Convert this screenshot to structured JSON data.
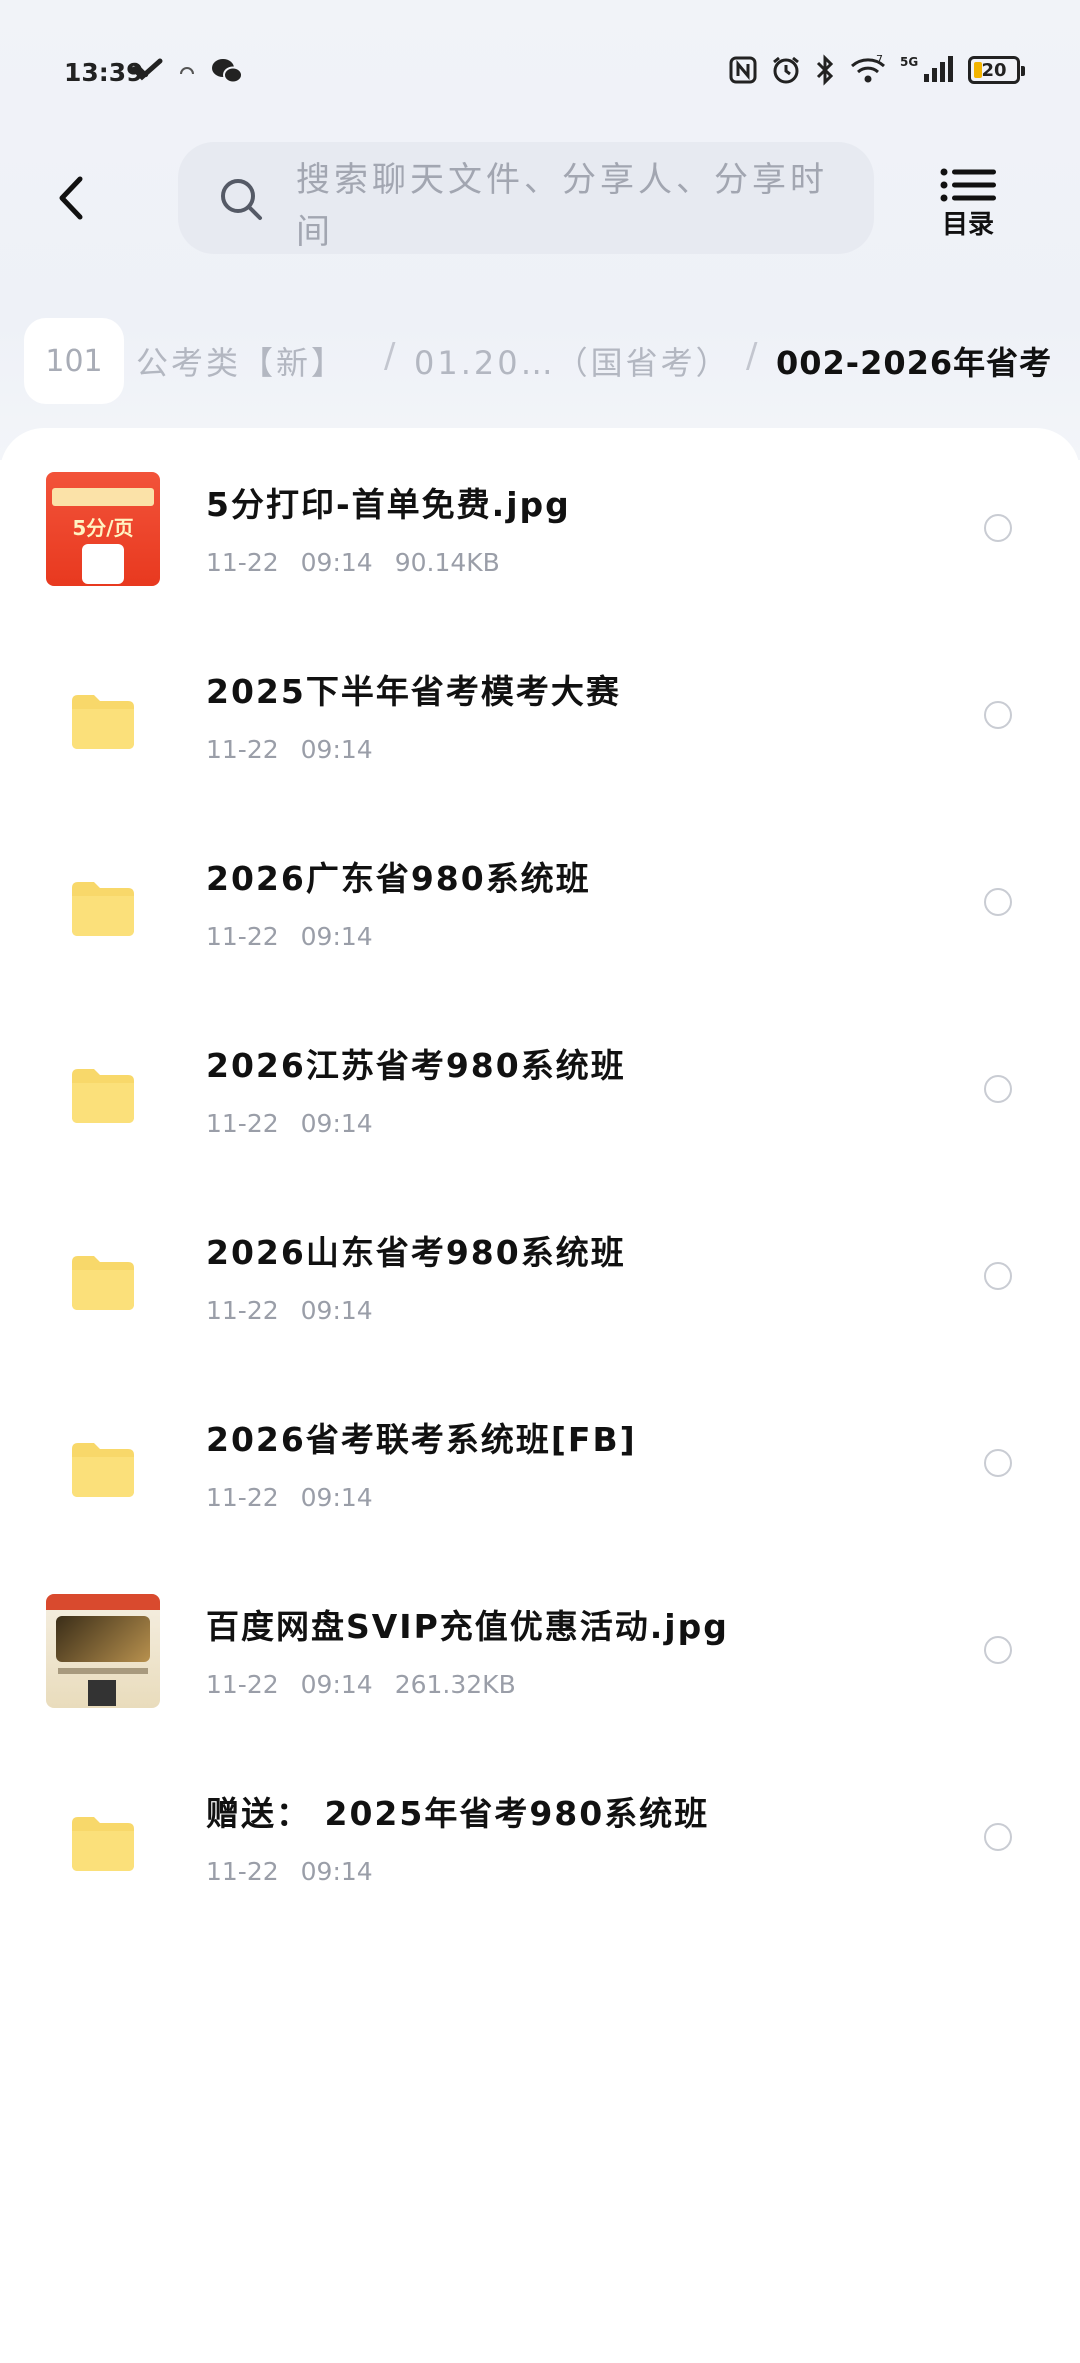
{
  "status_bar": {
    "time": "13:39",
    "battery": "20",
    "network": "5G",
    "wifi_badge": "7"
  },
  "header": {
    "search_placeholder": "搜索聊天文件、分享人、分享时间",
    "menu_label": "目录"
  },
  "breadcrumb": {
    "count": "101",
    "items": [
      {
        "label": "公考类【新】"
      },
      {
        "label": "01.20…（国省考）"
      },
      {
        "label": "002-2026年省考"
      }
    ]
  },
  "files": [
    {
      "name": "5分打印-首单免费.jpg",
      "date": "11-22",
      "time": "09:14",
      "size": "90.14KB",
      "type": "image",
      "thumb_text": "5分/页"
    },
    {
      "name": "2025下半年省考模考大赛",
      "date": "11-22",
      "time": "09:14",
      "size": "",
      "type": "folder"
    },
    {
      "name": "2026广东省980系统班",
      "date": "11-22",
      "time": "09:14",
      "size": "",
      "type": "folder"
    },
    {
      "name": "2026江苏省考980系统班",
      "date": "11-22",
      "time": "09:14",
      "size": "",
      "type": "folder"
    },
    {
      "name": "2026山东省考980系统班",
      "date": "11-22",
      "time": "09:14",
      "size": "",
      "type": "folder"
    },
    {
      "name": "2026省考联考系统班[FB]",
      "date": "11-22",
      "time": "09:14",
      "size": "",
      "type": "folder"
    },
    {
      "name": "百度网盘SVIP充值优惠活动.jpg",
      "date": "11-22",
      "time": "09:14",
      "size": "261.32KB",
      "type": "image"
    },
    {
      "name": "赠送： 2025年省考980系统班",
      "date": "11-22",
      "time": "09:14",
      "size": "",
      "type": "folder"
    }
  ],
  "colors": {
    "folder": "#f8d86a",
    "accent_text": "#111111",
    "meta_text": "#9a9ea8",
    "search_bg": "#e7eaf1"
  }
}
